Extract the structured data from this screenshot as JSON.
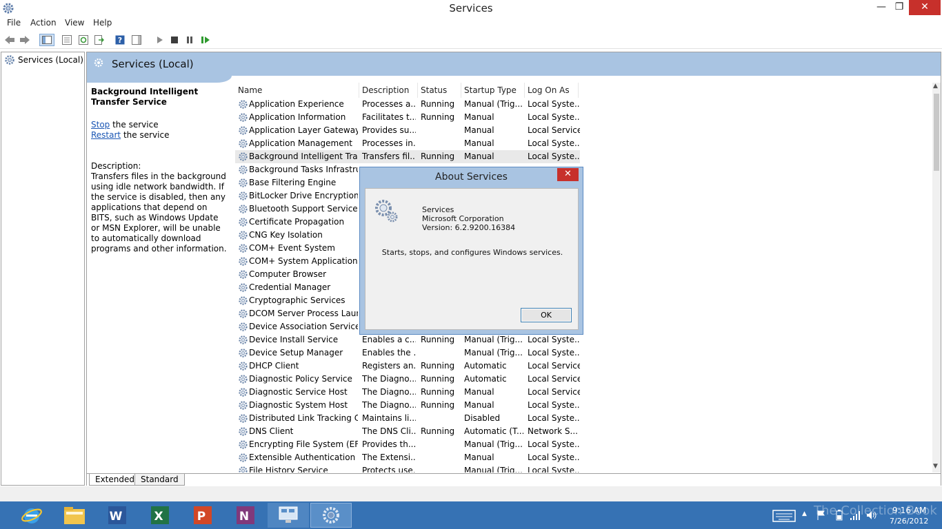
{
  "window": {
    "title": "Services",
    "min_icon": "minimize-icon",
    "max_icon": "restore-icon",
    "close_icon": "close-icon",
    "min_glyph": "—",
    "max_glyph": "❐",
    "close_glyph": "✕"
  },
  "menu": [
    "File",
    "Action",
    "View",
    "Help"
  ],
  "toolbar": [
    "back-arrow-icon",
    "forward-arrow-icon",
    "show-hide-console-tree-icon",
    "properties-icon",
    "refresh-icon",
    "export-list-icon",
    "help-icon",
    "show-hide-action-pane-icon",
    "start-service-icon",
    "stop-service-icon",
    "pause-service-icon",
    "resume-service-icon"
  ],
  "tree": {
    "label": "Services (Local)"
  },
  "header": {
    "title": "Services (Local)"
  },
  "details": {
    "service_name": "Background Intelligent Transfer Service",
    "stop_link": "Stop",
    "stop_suffix": " the service",
    "restart_link": "Restart",
    "restart_suffix": " the service",
    "description_label": "Description:",
    "description_text": "Transfers files in the background using idle network bandwidth. If the service is disabled, then any applications that depend on BITS, such as Windows Update or MSN Explorer, will be unable to automatically download programs and other information."
  },
  "columns": [
    "Name",
    "Description",
    "Status",
    "Startup Type",
    "Log On As"
  ],
  "sort_glyph": "^",
  "selected_row": 4,
  "services": [
    {
      "name": "Application Experience",
      "description": "Processes a...",
      "status": "Running",
      "startup": "Manual (Trig...",
      "logon": "Local Syste..."
    },
    {
      "name": "Application Information",
      "description": "Facilitates t...",
      "status": "Running",
      "startup": "Manual",
      "logon": "Local Syste..."
    },
    {
      "name": "Application Layer Gateway ...",
      "description": "Provides su...",
      "status": "",
      "startup": "Manual",
      "logon": "Local Service"
    },
    {
      "name": "Application Management",
      "description": "Processes in...",
      "status": "",
      "startup": "Manual",
      "logon": "Local Syste..."
    },
    {
      "name": "Background Intelligent Tran...",
      "description": "Transfers fil...",
      "status": "Running",
      "startup": "Manual",
      "logon": "Local Syste..."
    },
    {
      "name": "Background Tasks Infrastru...",
      "description": "",
      "status": "",
      "startup": "",
      "logon": ""
    },
    {
      "name": "Base Filtering Engine",
      "description": "",
      "status": "",
      "startup": "",
      "logon": ""
    },
    {
      "name": "BitLocker Drive Encryption ...",
      "description": "",
      "status": "",
      "startup": "",
      "logon": ""
    },
    {
      "name": "Bluetooth Support Service",
      "description": "",
      "status": "",
      "startup": "",
      "logon": ""
    },
    {
      "name": "Certificate Propagation",
      "description": "",
      "status": "",
      "startup": "",
      "logon": ""
    },
    {
      "name": "CNG Key Isolation",
      "description": "",
      "status": "",
      "startup": "",
      "logon": ""
    },
    {
      "name": "COM+ Event System",
      "description": "",
      "status": "",
      "startup": "",
      "logon": ""
    },
    {
      "name": "COM+ System Application",
      "description": "",
      "status": "",
      "startup": "",
      "logon": ""
    },
    {
      "name": "Computer Browser",
      "description": "",
      "status": "",
      "startup": "",
      "logon": ""
    },
    {
      "name": "Credential Manager",
      "description": "",
      "status": "",
      "startup": "",
      "logon": ""
    },
    {
      "name": "Cryptographic Services",
      "description": "",
      "status": "",
      "startup": "",
      "logon": ""
    },
    {
      "name": "DCOM Server Process Laun...",
      "description": "",
      "status": "",
      "startup": "",
      "logon": ""
    },
    {
      "name": "Device Association Service",
      "description": "",
      "status": "",
      "startup": "",
      "logon": ""
    },
    {
      "name": "Device Install Service",
      "description": "Enables a c...",
      "status": "Running",
      "startup": "Manual (Trig...",
      "logon": "Local Syste..."
    },
    {
      "name": "Device Setup Manager",
      "description": "Enables the ...",
      "status": "",
      "startup": "Manual (Trig...",
      "logon": "Local Syste..."
    },
    {
      "name": "DHCP Client",
      "description": "Registers an...",
      "status": "Running",
      "startup": "Automatic",
      "logon": "Local Service"
    },
    {
      "name": "Diagnostic Policy Service",
      "description": "The Diagno...",
      "status": "Running",
      "startup": "Automatic",
      "logon": "Local Service"
    },
    {
      "name": "Diagnostic Service Host",
      "description": "The Diagno...",
      "status": "Running",
      "startup": "Manual",
      "logon": "Local Service"
    },
    {
      "name": "Diagnostic System Host",
      "description": "The Diagno...",
      "status": "Running",
      "startup": "Manual",
      "logon": "Local Syste..."
    },
    {
      "name": "Distributed Link Tracking Cl...",
      "description": "Maintains li...",
      "status": "",
      "startup": "Disabled",
      "logon": "Local Syste..."
    },
    {
      "name": "DNS Client",
      "description": "The DNS Cli...",
      "status": "Running",
      "startup": "Automatic (T...",
      "logon": "Network S..."
    },
    {
      "name": "Encrypting File System (EFS)",
      "description": "Provides th...",
      "status": "",
      "startup": "Manual (Trig...",
      "logon": "Local Syste..."
    },
    {
      "name": "Extensible Authentication P...",
      "description": "The Extensi...",
      "status": "",
      "startup": "Manual",
      "logon": "Local Syste..."
    },
    {
      "name": "File History Service",
      "description": "Protects use...",
      "status": "",
      "startup": "Manual (Trig...",
      "logon": "Local Syste..."
    }
  ],
  "tabs": [
    "Extended",
    "Standard"
  ],
  "dialog": {
    "title": "About Services",
    "close_glyph": "✕",
    "product": "Services",
    "company": "Microsoft Corporation",
    "version": "Version: 6.2.9200.16384",
    "description": "Starts, stops, and configures Windows services.",
    "ok_label": "OK"
  },
  "scrollbar": {
    "up_glyph": "▲",
    "down_glyph": "▼"
  },
  "taskbar": {
    "apps": [
      "internet-explorer-icon",
      "file-explorer-icon",
      "word-icon",
      "excel-icon",
      "powerpoint-icon",
      "onenote-icon",
      "remote-desktop-icon",
      "services-icon"
    ],
    "tray_up_glyph": "▲",
    "time": "9:16 AM",
    "date": "7/26/2012",
    "watermark": "The Collection Book"
  },
  "colors": {
    "accent": "#a9c4e2",
    "taskbar": "#3672b4",
    "close": "#c7302b",
    "link": "#1a56b4"
  }
}
